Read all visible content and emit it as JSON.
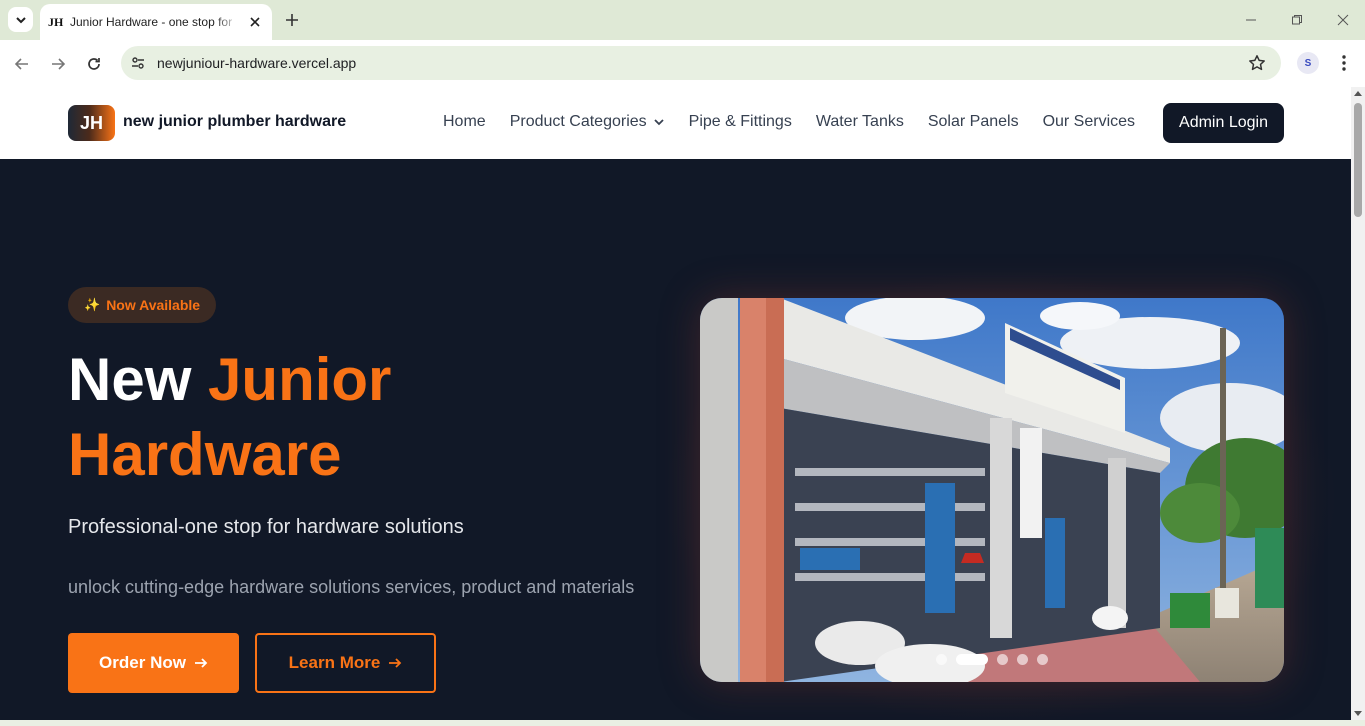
{
  "browser": {
    "tab_title": "Junior Hardware - one stop for",
    "tab_favicon": "JH",
    "url": "newjuniour-hardware.vercel.app",
    "profile_initial": "S"
  },
  "site": {
    "logo": "JH",
    "brand": "new junior plumber hardware",
    "nav": {
      "home": "Home",
      "categories": "Product Categories",
      "pipes": "Pipe & Fittings",
      "tanks": "Water Tanks",
      "solar": "Solar Panels",
      "services": "Our Services"
    },
    "admin_login": "Admin Login"
  },
  "hero": {
    "badge_icon": "✨",
    "badge": "Now Available",
    "title_white": "New ",
    "title_accent": "Junior Hardware",
    "subtitle": "Professional-one stop for hardware solutions",
    "description": "unlock cutting-edge hardware solutions services, product and materials",
    "order_now": "Order Now",
    "learn_more": "Learn More",
    "carousel": {
      "slides": 5,
      "active_index": 1
    },
    "colors": {
      "accent": "#f97316",
      "background": "#111827"
    }
  }
}
